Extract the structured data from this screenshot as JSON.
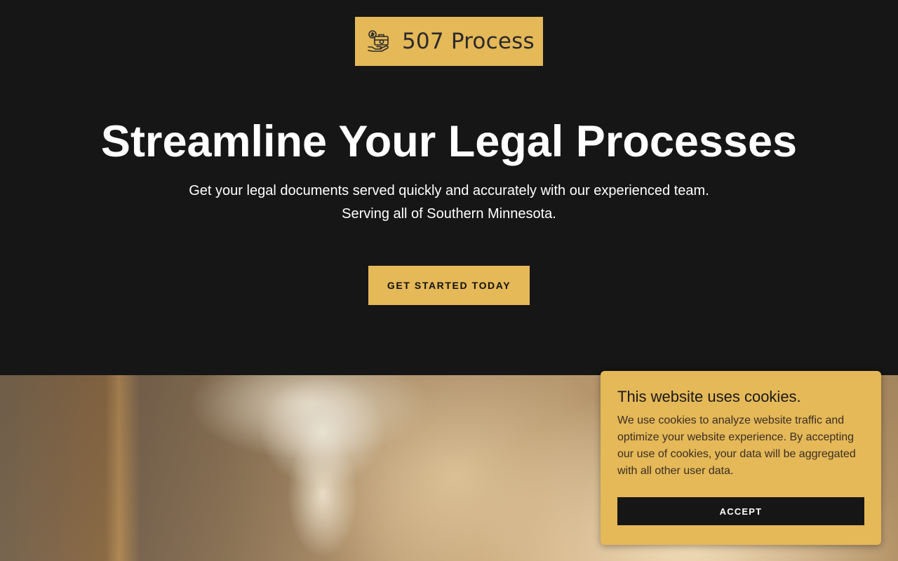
{
  "logo": {
    "text": "507 Process",
    "icon": "briefcase-money-hand-icon"
  },
  "hero": {
    "title": "Streamline Your Legal Processes",
    "subtitle_line1": "Get your legal documents served quickly and accurately with our experienced team.",
    "subtitle_line2": "Serving all of Southern Minnesota.",
    "cta_label": "GET STARTED TODAY"
  },
  "cookie_banner": {
    "title": "This website uses cookies.",
    "body": "We use cookies to analyze website traffic and optimize your website experience. By accepting our use of cookies, your data will be aggregated with all other user data.",
    "accept_label": "ACCEPT"
  },
  "colors": {
    "accent": "#e5b858",
    "background": "#161616",
    "text_light": "#ffffff"
  }
}
